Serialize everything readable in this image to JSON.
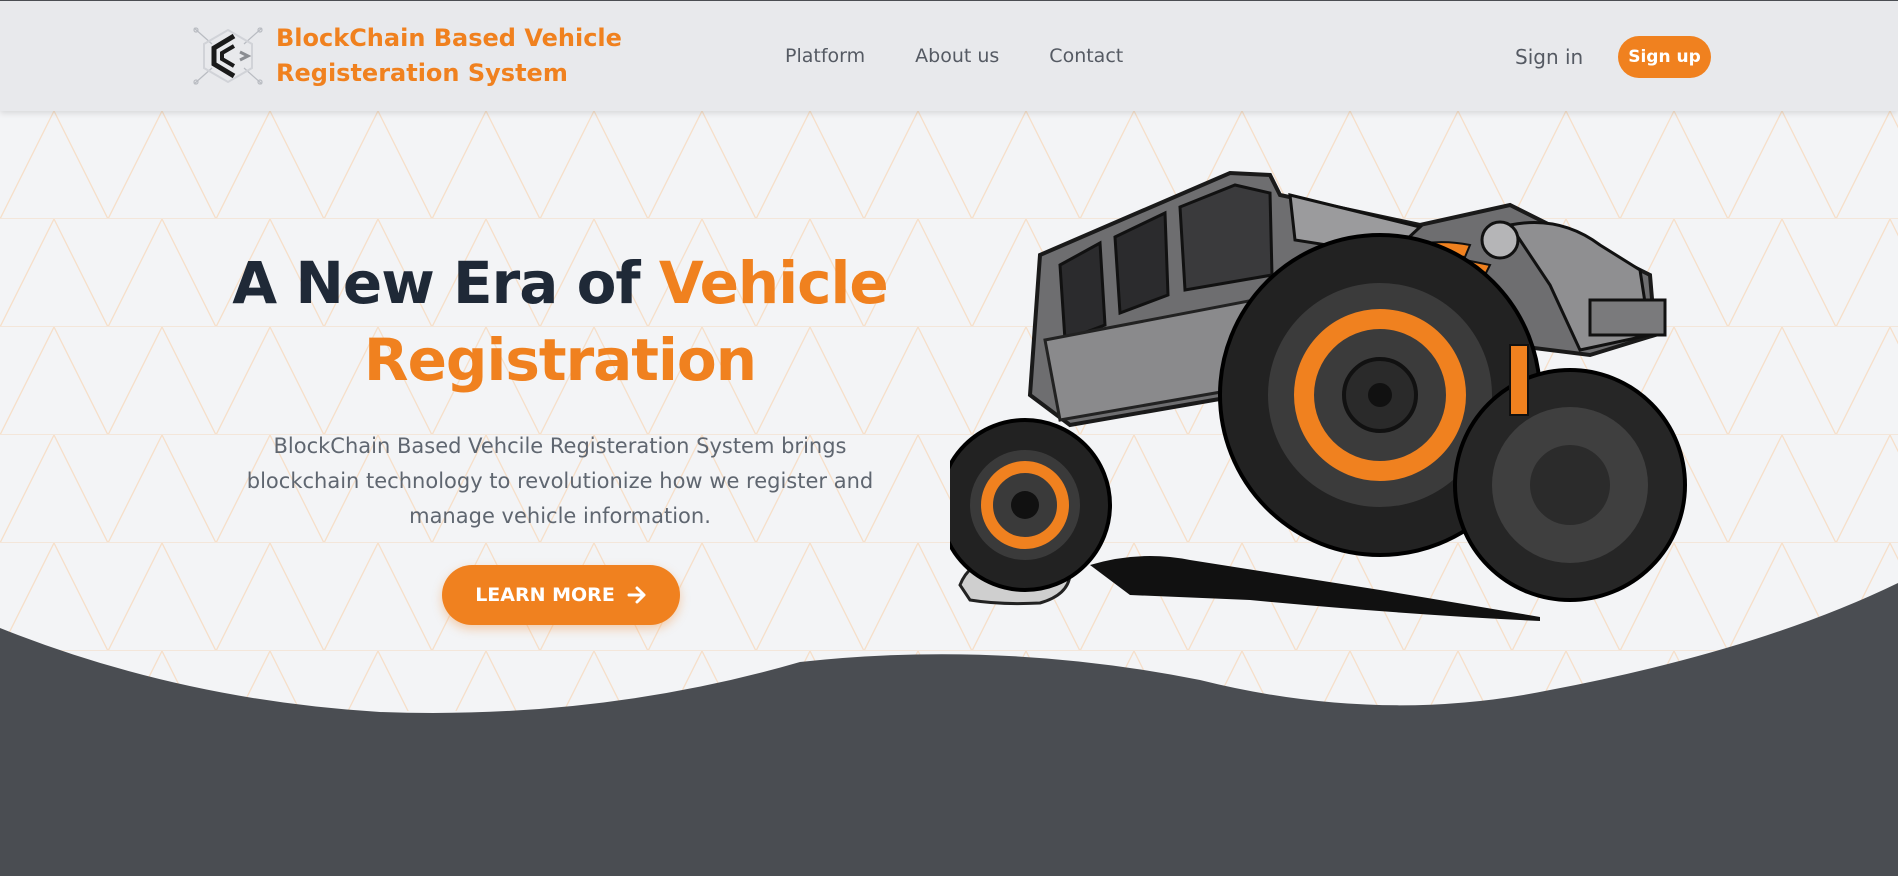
{
  "header": {
    "brand_line1": "BlockChain Based Vehicle",
    "brand_line2": "Registeration System",
    "logo_icon": "blockchain-logo-icon",
    "nav": [
      {
        "label": "Platform"
      },
      {
        "label": "About us"
      },
      {
        "label": "Contact"
      }
    ],
    "signin_label": "Sign in",
    "signup_label": "Sign up"
  },
  "hero": {
    "title_part1": "A New Era of ",
    "title_accent_1": "Vehicle",
    "title_accent_2": "Registration",
    "description": "BlockChain Based Vehcile Registeration System brings blockchain technology to revolutionize how we register and manage vehicle information.",
    "cta_label": "LEARN MORE",
    "cta_icon": "arrow-right-icon",
    "image": "off-road-jeep-illustration"
  },
  "colors": {
    "accent": "#f0811f",
    "dark": "#1f2937",
    "footer": "#4a4d52",
    "header_bg": "#e8e9ec"
  }
}
